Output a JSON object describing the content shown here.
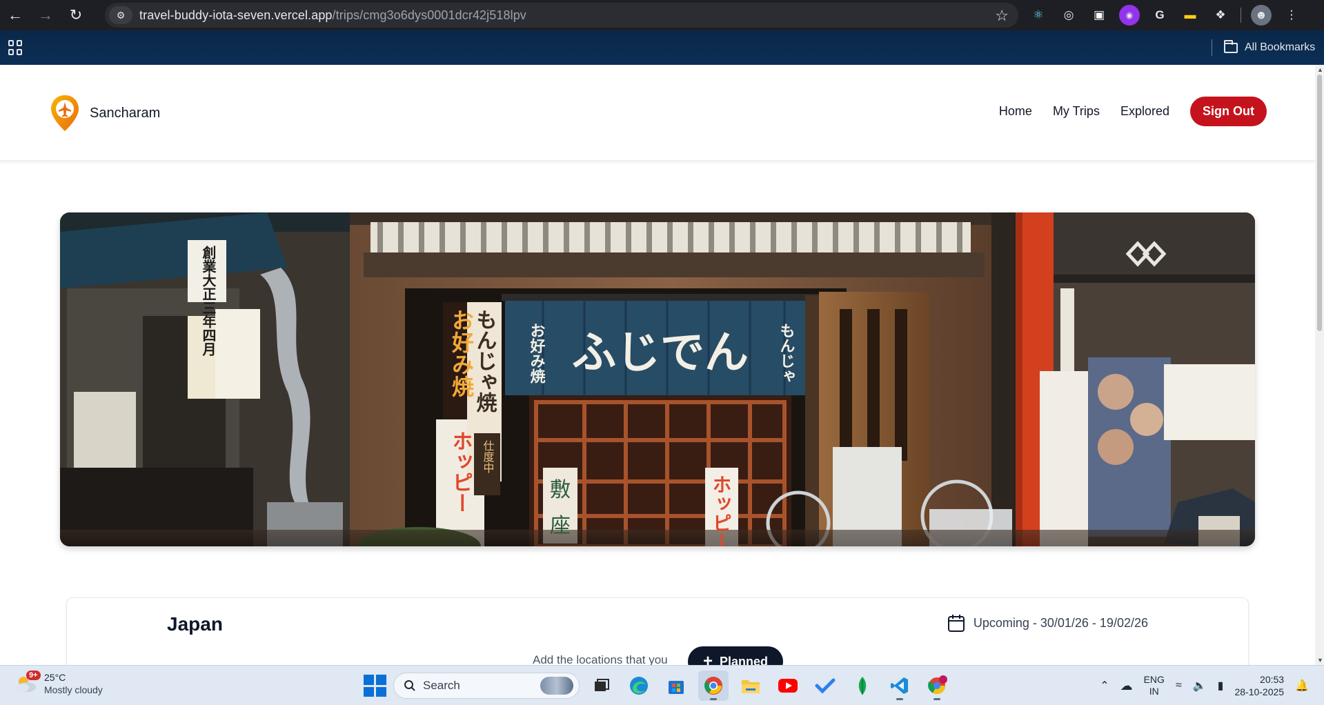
{
  "browser": {
    "url_host": "travel-buddy-iota-seven.vercel.app",
    "url_path": "/trips/cmg3o6dys0001dcr42j518lpv",
    "bookmarks_label": "All Bookmarks"
  },
  "site": {
    "brand_name": "Sancharam",
    "nav": {
      "home": "Home",
      "my_trips": "My Trips",
      "explored": "Explored",
      "sign_out": "Sign Out"
    }
  },
  "hero": {
    "sign_main": "ふじでん",
    "sign_left": "お好み焼",
    "sign_right": "もんじゃ",
    "sign_banner_left": "創業大正三年四月",
    "sign_tall_1": "お好み焼",
    "sign_tall_2": "もんじゃ焼",
    "sign_hoppy": "ホッピー",
    "sign_shikiza_1": "敷",
    "sign_shikiza_2": "座",
    "sign_shichu": "仕度中"
  },
  "trip": {
    "title": "Japan",
    "date_text": "Upcoming - 30/01/26 - 19/02/26",
    "hint": "Add the locations that you",
    "status_button": "Planned"
  },
  "taskbar": {
    "weather_badge": "9+",
    "temperature": "25°C",
    "weather_desc": "Mostly cloudy",
    "search_placeholder": "Search",
    "lang_line1": "ENG",
    "lang_line2": "IN",
    "time": "20:53",
    "date": "28-10-2025"
  },
  "colors": {
    "brand_red": "#c5131d",
    "dark_navy": "#0f172a",
    "pin_orange": "#f59e0b"
  }
}
